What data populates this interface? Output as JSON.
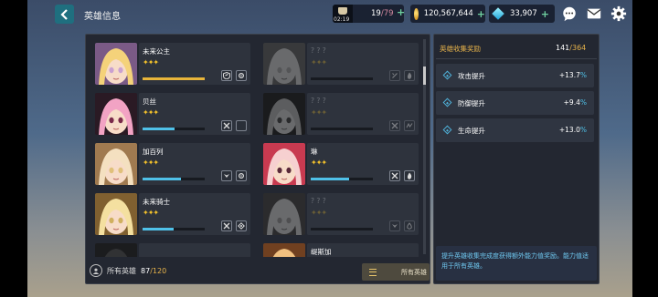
{
  "header": {
    "title": "英雄信息"
  },
  "resources": {
    "stamina_timer": "02:19",
    "stamina_current": "19",
    "stamina_max": "/79",
    "gold": "120,567,644",
    "gems": "33,907"
  },
  "heroes": [
    {
      "name": "未来公主",
      "stars": "✦✦✦",
      "progress": 1.0,
      "locked": false,
      "bar_color": "#e8b53a",
      "portrait_colors": [
        "#f4d27a",
        "#caa1d0",
        "#7a5a86"
      ],
      "badges": [
        "shield-icon",
        "gear-icon"
      ]
    },
    {
      "name": "? ? ?",
      "stars": "✦✦✦",
      "progress": 0,
      "locked": true,
      "bar_color": "#4fc1e8",
      "portrait_colors": [
        "#e0e0e0",
        "#b0b0b0",
        "#707070"
      ],
      "badges": [
        "slash-icon",
        "flame-icon"
      ]
    },
    {
      "name": "贝丝",
      "stars": "✦✦✦",
      "progress": 0.52,
      "locked": false,
      "bar_color": "#4fc1e8",
      "portrait_colors": [
        "#f2a3c4",
        "#7a2a4a",
        "#2a1a24"
      ],
      "badges": [
        "swords-icon",
        "moon-icon"
      ]
    },
    {
      "name": "? ? ?",
      "stars": "✦✦✦",
      "progress": 0,
      "locked": true,
      "bar_color": "#4fc1e8",
      "portrait_colors": [
        "#e8c070",
        "#a03a2a",
        "#3a2a2a"
      ],
      "badges": [
        "swords-icon",
        "wave-icon"
      ]
    },
    {
      "name": "加百列",
      "stars": "✦✦✦",
      "progress": 0.62,
      "locked": false,
      "bar_color": "#4fc1e8",
      "portrait_colors": [
        "#f4e0c0",
        "#e0c07a",
        "#a07a50"
      ],
      "badges": [
        "wing-icon",
        "gear-icon"
      ]
    },
    {
      "name": "琳",
      "stars": "✦✦✦",
      "progress": 0.62,
      "locked": false,
      "bar_color": "#4fc1e8",
      "portrait_colors": [
        "#f6d0d0",
        "#5a2a3a",
        "#c83a50"
      ],
      "badges": [
        "swords-icon",
        "flame-icon"
      ]
    },
    {
      "name": "未来骑士",
      "stars": "✦✦✦",
      "progress": 0.5,
      "locked": false,
      "bar_color": "#4fc1e8",
      "portrait_colors": [
        "#f4e0a0",
        "#d0b060",
        "#806030"
      ],
      "badges": [
        "swords-icon",
        "diamond-icon"
      ]
    },
    {
      "name": "? ? ?",
      "stars": "✦✦✦",
      "progress": 0,
      "locked": true,
      "bar_color": "#4fc1e8",
      "portrait_colors": [
        "#f0e0b0",
        "#c0a070",
        "#605040"
      ],
      "badges": [
        "wing-icon",
        "drop-icon"
      ]
    },
    {
      "name": "",
      "stars": "",
      "progress": 0,
      "locked": true,
      "bar_color": "#4fc1e8",
      "portrait_colors": [
        "#606060",
        "#404040",
        "#303030"
      ],
      "badges": []
    },
    {
      "name": "缇斯加",
      "stars": "",
      "progress": 0,
      "locked": false,
      "bar_color": "#4fc1e8",
      "portrait_colors": [
        "#f0c080",
        "#c08040",
        "#704020"
      ],
      "badges": []
    }
  ],
  "footer": {
    "label": "所有英雄",
    "count_current": "87",
    "count_max": "/120",
    "filter_label": "所有英雄"
  },
  "collection": {
    "title": "英雄收集奖励",
    "current": "141",
    "max": "/364",
    "stats": [
      {
        "label": "攻击提升",
        "value": "+13.7",
        "unit": "%"
      },
      {
        "label": "防御提升",
        "value": "+9.4",
        "unit": "%"
      },
      {
        "label": "生命提升",
        "value": "+13.0",
        "unit": "%"
      }
    ],
    "note": "提升英雄收集完成度获得额外能力值奖励。能力值适用于所有英雄。"
  },
  "colors": {
    "accent_gold": "#e6b24a",
    "accent_blue": "#4fc1e8",
    "panel": "#232731"
  }
}
